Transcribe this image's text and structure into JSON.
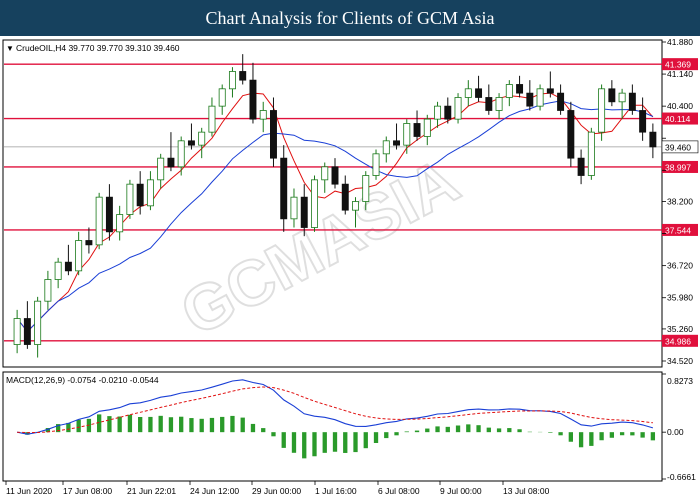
{
  "header": {
    "title": "Chart Analysis for Clients of GCM Asia"
  },
  "chart_data": {
    "type": "candlestick",
    "price_panel": {
      "symbol_info": "CrudeOIL,H4  39.770 39.770 39.310 39.460",
      "ohlc": {
        "open": 39.77,
        "high": 39.77,
        "low": 39.31,
        "close": 39.46
      },
      "ylim": [
        34.52,
        41.88
      ],
      "y_ticks": [
        "41.880",
        "41.140",
        "40.400",
        "39.660",
        "38.920",
        "38.200",
        "37.460",
        "36.720",
        "35.980",
        "35.260",
        "34.520"
      ],
      "horizontal_levels": [
        {
          "value": 41.369,
          "label": "41.369"
        },
        {
          "value": 40.114,
          "label": "40.114"
        },
        {
          "value": 38.997,
          "label": "38.997"
        },
        {
          "value": 37.544,
          "label": "37.544"
        },
        {
          "value": 34.986,
          "label": "34.986"
        }
      ],
      "current_price": {
        "value": 39.46,
        "label": "39.460"
      },
      "candles": [
        [
          34.9,
          35.7,
          34.7,
          35.5
        ],
        [
          35.5,
          35.9,
          34.8,
          34.9
        ],
        [
          34.9,
          36.0,
          34.6,
          35.9
        ],
        [
          35.9,
          36.6,
          35.7,
          36.4
        ],
        [
          36.4,
          36.9,
          36.2,
          36.8
        ],
        [
          36.8,
          37.2,
          36.5,
          36.6
        ],
        [
          36.6,
          37.5,
          36.5,
          37.3
        ],
        [
          37.3,
          37.6,
          37.0,
          37.2
        ],
        [
          37.2,
          38.4,
          37.1,
          38.3
        ],
        [
          38.3,
          38.6,
          37.3,
          37.5
        ],
        [
          37.5,
          38.1,
          37.3,
          37.9
        ],
        [
          37.9,
          38.7,
          37.8,
          38.6
        ],
        [
          38.6,
          38.9,
          37.9,
          38.1
        ],
        [
          38.1,
          38.9,
          38.0,
          38.7
        ],
        [
          38.7,
          39.3,
          38.5,
          39.2
        ],
        [
          39.2,
          39.8,
          38.9,
          39.0
        ],
        [
          39.0,
          39.7,
          38.8,
          39.6
        ],
        [
          39.6,
          40.0,
          39.4,
          39.5
        ],
        [
          39.5,
          39.9,
          39.2,
          39.8
        ],
        [
          39.8,
          40.6,
          39.7,
          40.4
        ],
        [
          40.4,
          40.9,
          40.2,
          40.8
        ],
        [
          40.8,
          41.3,
          40.6,
          41.2
        ],
        [
          41.2,
          41.6,
          40.9,
          41.0
        ],
        [
          41.0,
          41.4,
          40.0,
          40.1
        ],
        [
          40.1,
          40.5,
          39.8,
          40.3
        ],
        [
          40.3,
          40.6,
          39.0,
          39.2
        ],
        [
          39.2,
          39.5,
          37.5,
          37.8
        ],
        [
          37.8,
          38.5,
          37.6,
          38.3
        ],
        [
          38.3,
          38.6,
          37.4,
          37.6
        ],
        [
          37.6,
          38.8,
          37.5,
          38.7
        ],
        [
          38.7,
          39.1,
          38.4,
          39.0
        ],
        [
          39.0,
          39.2,
          38.5,
          38.6
        ],
        [
          38.6,
          38.8,
          37.9,
          38.0
        ],
        [
          38.0,
          38.3,
          37.6,
          38.2
        ],
        [
          38.2,
          38.9,
          38.0,
          38.8
        ],
        [
          38.8,
          39.4,
          38.7,
          39.3
        ],
        [
          39.3,
          39.7,
          39.1,
          39.6
        ],
        [
          39.6,
          40.0,
          39.4,
          39.5
        ],
        [
          39.5,
          40.1,
          39.3,
          40.0
        ],
        [
          40.0,
          40.3,
          39.6,
          39.7
        ],
        [
          39.7,
          40.2,
          39.5,
          40.1
        ],
        [
          40.1,
          40.5,
          39.9,
          40.4
        ],
        [
          40.4,
          40.6,
          40.0,
          40.1
        ],
        [
          40.1,
          40.7,
          40.0,
          40.6
        ],
        [
          40.6,
          41.0,
          40.4,
          40.8
        ],
        [
          40.8,
          41.1,
          40.5,
          40.6
        ],
        [
          40.6,
          40.9,
          40.2,
          40.3
        ],
        [
          40.3,
          40.7,
          40.1,
          40.6
        ],
        [
          40.6,
          41.0,
          40.4,
          40.9
        ],
        [
          40.9,
          41.1,
          40.6,
          40.7
        ],
        [
          40.7,
          41.0,
          40.3,
          40.4
        ],
        [
          40.4,
          40.9,
          40.3,
          40.8
        ],
        [
          40.8,
          41.2,
          40.6,
          40.7
        ],
        [
          40.7,
          40.9,
          40.2,
          40.3
        ],
        [
          40.3,
          40.5,
          39.0,
          39.2
        ],
        [
          39.2,
          39.4,
          38.6,
          38.8
        ],
        [
          38.8,
          39.9,
          38.7,
          39.8
        ],
        [
          39.8,
          40.9,
          39.6,
          40.8
        ],
        [
          40.8,
          41.0,
          40.4,
          40.5
        ],
        [
          40.5,
          40.8,
          40.1,
          40.7
        ],
        [
          40.7,
          40.9,
          40.2,
          40.3
        ],
        [
          40.3,
          40.6,
          39.6,
          39.8
        ],
        [
          39.8,
          40.0,
          39.2,
          39.46
        ]
      ]
    },
    "macd_panel": {
      "label": "MACD(12,26,9)  -0.0754  -0.0210  -0.0544",
      "params": [
        12,
        26,
        9
      ],
      "values": {
        "macd": -0.0754,
        "signal": -0.021,
        "histogram": -0.0544
      },
      "ylim": [
        -0.6661,
        0.8273
      ],
      "y_ticks": [
        "0.8273",
        "0.00",
        "-0.6661"
      ],
      "colors": {
        "macd": "#1a3fd6",
        "signal": "#e01010",
        "histogram": "#2a9a2a"
      }
    },
    "x_ticks": [
      "11 Jun 2020",
      "17 Jun 08:00",
      "21 Jun 22:01",
      "24 Jun 12:00",
      "29 Jun 00:00",
      "1 Jul 16:00",
      "6 Jul 08:00",
      "9 Jul 00:00",
      "13 Jul 08:00"
    ],
    "colors": {
      "header_bg": "#16415e",
      "level_line": "#e0103c",
      "ma_fast": "#e01010",
      "ma_slow": "#1a3fd6",
      "candle_up": "#1b7a1b",
      "candle_down": "#111111"
    },
    "watermark": "GCMASIA"
  }
}
